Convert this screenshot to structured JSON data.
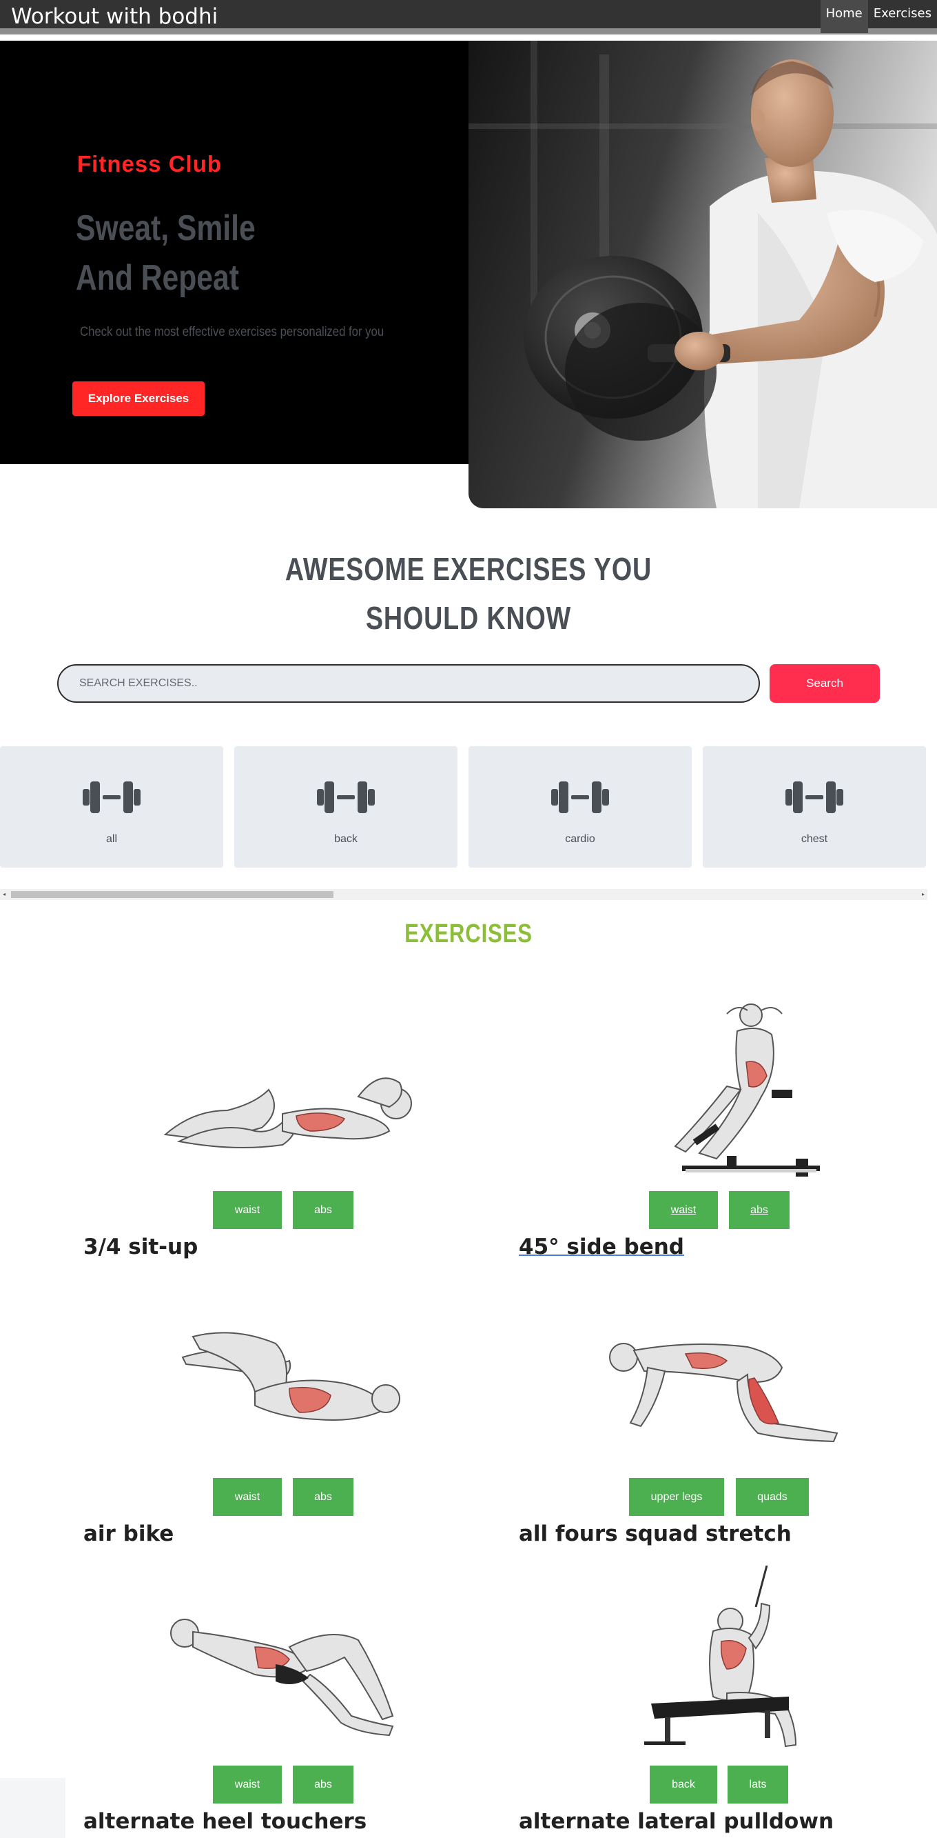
{
  "navbar": {
    "brand": "Workout with bodhi",
    "links": [
      {
        "label": "Home",
        "active": true
      },
      {
        "label": "Exercises",
        "active": false
      }
    ]
  },
  "hero": {
    "tag": "Fitness Club",
    "title_line1": "Sweat, Smile",
    "title_line2": "And Repeat",
    "subtitle": "Check out the most effective exercises personalized for you",
    "button": "Explore Exercises",
    "image_alt": "man lifting dumbbell"
  },
  "search_section": {
    "title_line1": "AWESOME EXERCISES YOU",
    "title_line2": "SHOULD KNOW",
    "placeholder": "SEARCH EXERCISES..",
    "value": "",
    "button": "Search"
  },
  "categories": [
    {
      "label": "all",
      "icon": "dumbbell-icon"
    },
    {
      "label": "back",
      "icon": "dumbbell-icon"
    },
    {
      "label": "cardio",
      "icon": "dumbbell-icon"
    },
    {
      "label": "chest",
      "icon": "dumbbell-icon"
    }
  ],
  "exercises_heading": "EXERCISES",
  "exercises": [
    {
      "name": "3/4 sit-up",
      "tags": [
        "waist",
        "abs"
      ]
    },
    {
      "name": "45° side bend",
      "tags": [
        "waist",
        "abs"
      ]
    },
    {
      "name": "air bike",
      "tags": [
        "waist",
        "abs"
      ]
    },
    {
      "name": "all fours squad stretch",
      "tags": [
        "upper legs",
        "quads"
      ]
    },
    {
      "name": "alternate heel touchers",
      "tags": [
        "waist",
        "abs"
      ]
    },
    {
      "name": "alternate lateral pulldown",
      "tags": [
        "back",
        "lats"
      ]
    }
  ],
  "colors": {
    "accent_red": "#ff2625",
    "search_button": "#ff2e4f",
    "tag_green": "#4caf50",
    "exercises_heading": "#8dbe3a",
    "text_dark": "#4a4e55",
    "navbar": "#333333"
  }
}
